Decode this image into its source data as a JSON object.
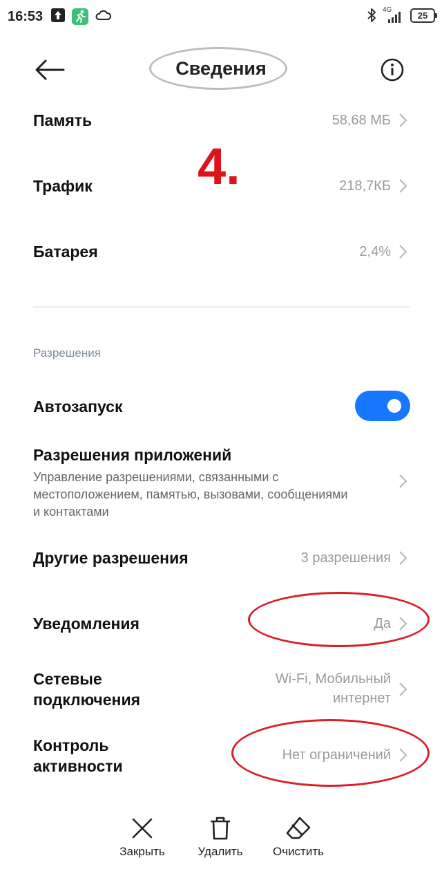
{
  "status_bar": {
    "time": "16:53",
    "network": "4G",
    "battery": "25"
  },
  "header": {
    "title": "Сведения"
  },
  "annotation": "4.",
  "rows": [
    {
      "label": "Память",
      "value": "58,68 МБ"
    },
    {
      "label": "Трафик",
      "value": "218,7КБ"
    },
    {
      "label": "Батарея",
      "value": "2,4%"
    }
  ],
  "permissions": {
    "section_title": "Разрешения",
    "autostart": {
      "label": "Автозапуск",
      "enabled": true
    },
    "app_permissions": {
      "label": "Разрешения приложений",
      "desc_lines": [
        "Управление разрешениями, связанными с",
        "местоположением, памятью, вызовами, сообщениями",
        "и контактами"
      ]
    },
    "other": {
      "label": "Другие разрешения",
      "value": "3 разрешения"
    },
    "notifications": {
      "label": "Уведомления",
      "value": "Да"
    },
    "network": {
      "label_lines": [
        "Сетевые",
        "подключения"
      ],
      "value_lines": [
        "Wi-Fi, Мобильный",
        "интернет"
      ]
    },
    "activity": {
      "label_lines": [
        "Контроль",
        "активности"
      ],
      "value": "Нет ограничений"
    }
  },
  "bottom_bar": {
    "close": "Закрыть",
    "delete": "Удалить",
    "clear": "Очистить"
  },
  "colors": {
    "accent": "#1677ff",
    "annotation_red": "#e0111a"
  }
}
